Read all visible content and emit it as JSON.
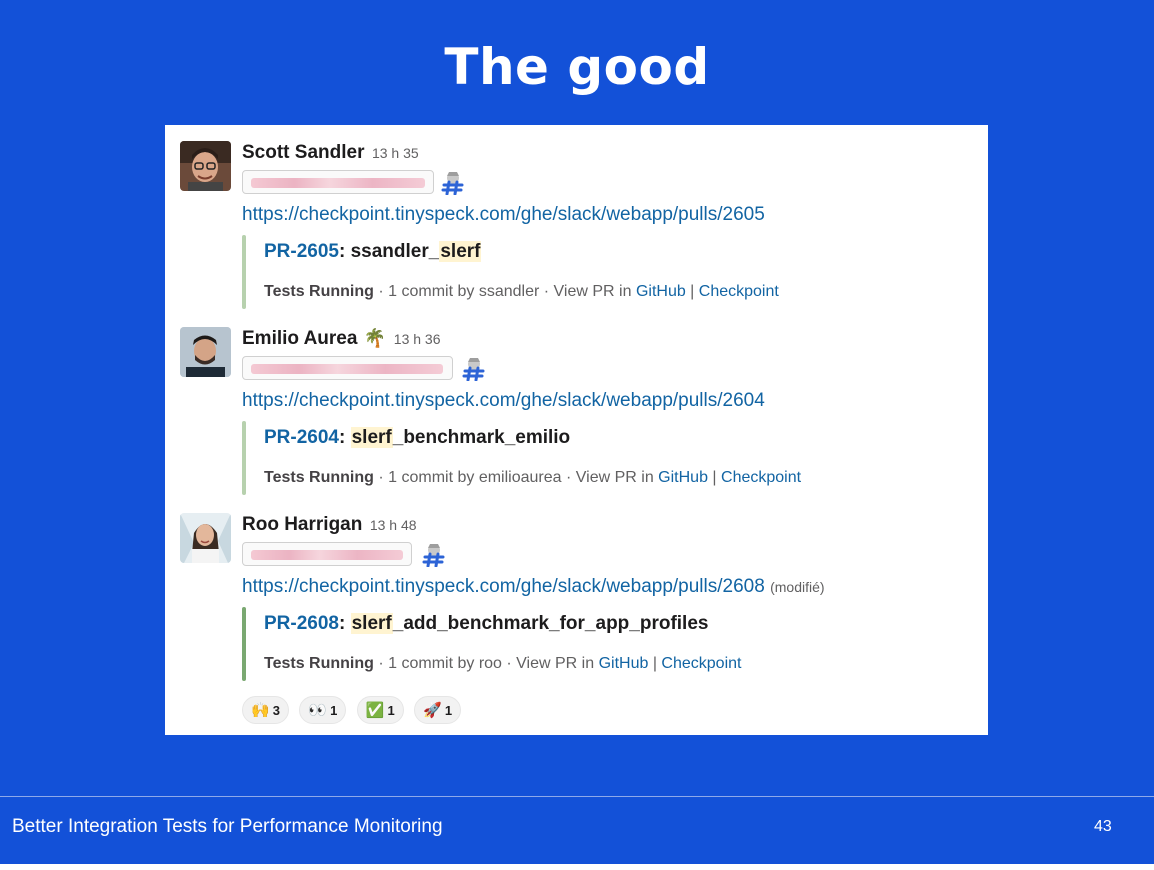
{
  "slide": {
    "title": "The good",
    "footer": "Better Integration Tests for Performance Monitoring",
    "page_number": "43"
  },
  "messages": [
    {
      "author": "Scott Sandler",
      "status_emoji": "",
      "time": "13 h 35",
      "url": "https://checkpoint.tinyspeck.com/ghe/slack/webapp/pulls/2605",
      "modified": "",
      "pr_link": "PR-2605",
      "pr_title_pre": "ssandler_",
      "pr_title_hl": "slerf",
      "pr_title_post": "",
      "status": "Tests Running",
      "commit_text": " · 1 commit by ssandler · View PR in ",
      "github": "GitHub",
      "sep": " | ",
      "checkpoint": "Checkpoint"
    },
    {
      "author": "Emilio Aurea",
      "status_emoji": "🌴",
      "time": "13 h 36",
      "url": "https://checkpoint.tinyspeck.com/ghe/slack/webapp/pulls/2604",
      "modified": "",
      "pr_link": "PR-2604",
      "pr_title_pre": "",
      "pr_title_hl": "slerf",
      "pr_title_post": "_benchmark_emilio",
      "status": "Tests Running",
      "commit_text": " · 1 commit by emilioaurea · View PR in ",
      "github": "GitHub",
      "sep": " | ",
      "checkpoint": "Checkpoint"
    },
    {
      "author": "Roo Harrigan",
      "status_emoji": "",
      "time": "13 h 48",
      "url": "https://checkpoint.tinyspeck.com/ghe/slack/webapp/pulls/2608",
      "modified": "(modifié)",
      "pr_link": "PR-2608",
      "pr_title_pre": "",
      "pr_title_hl": "slerf",
      "pr_title_post": "_add_benchmark_for_app_profiles",
      "status": "Tests Running",
      "commit_text": " · 1 commit by roo · View PR in ",
      "github": "GitHub",
      "sep": " | ",
      "checkpoint": "Checkpoint"
    }
  ],
  "reactions": [
    {
      "emoji": "🙌",
      "icon": "raised-hands-icon",
      "count": "3"
    },
    {
      "emoji": "👀",
      "icon": "eyes-icon",
      "count": "1"
    },
    {
      "emoji": "✅",
      "icon": "check-mark-icon",
      "count": "1"
    },
    {
      "emoji": "🚀",
      "icon": "rocket-icon",
      "count": "1"
    }
  ],
  "colors": {
    "slide_background": "#1351d8",
    "link": "#1264a3",
    "attachment_bar": "#b7d1ae"
  }
}
